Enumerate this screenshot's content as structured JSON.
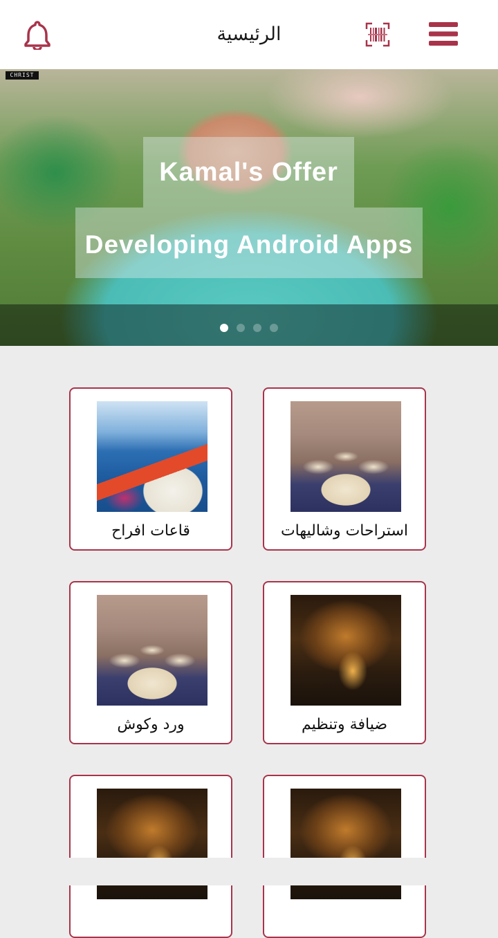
{
  "header": {
    "title": "الرئيسية",
    "icons": [
      "bell-icon",
      "barcode-scan-icon",
      "menu-icon"
    ],
    "accent_color": "#a8334a"
  },
  "banner": {
    "logo_text": "CHRIST",
    "caption_title": "Kamal's Offer",
    "caption_subtitle": "Developing Android Apps",
    "slide_count": 4,
    "active_slide": 1
  },
  "categories": [
    {
      "label": "استراحات وشاليهات",
      "image": "banquet-hall-photo"
    },
    {
      "label": "قاعات افراح",
      "image": "seaside-village-photo"
    },
    {
      "label": "ضيافة وتنظيم",
      "image": "night-garden-event-photo"
    },
    {
      "label": "ورد وكوش",
      "image": "banquet-hall-photo"
    },
    {
      "label": "",
      "image": "night-garden-event-photo"
    },
    {
      "label": "",
      "image": "night-garden-event-photo"
    }
  ]
}
